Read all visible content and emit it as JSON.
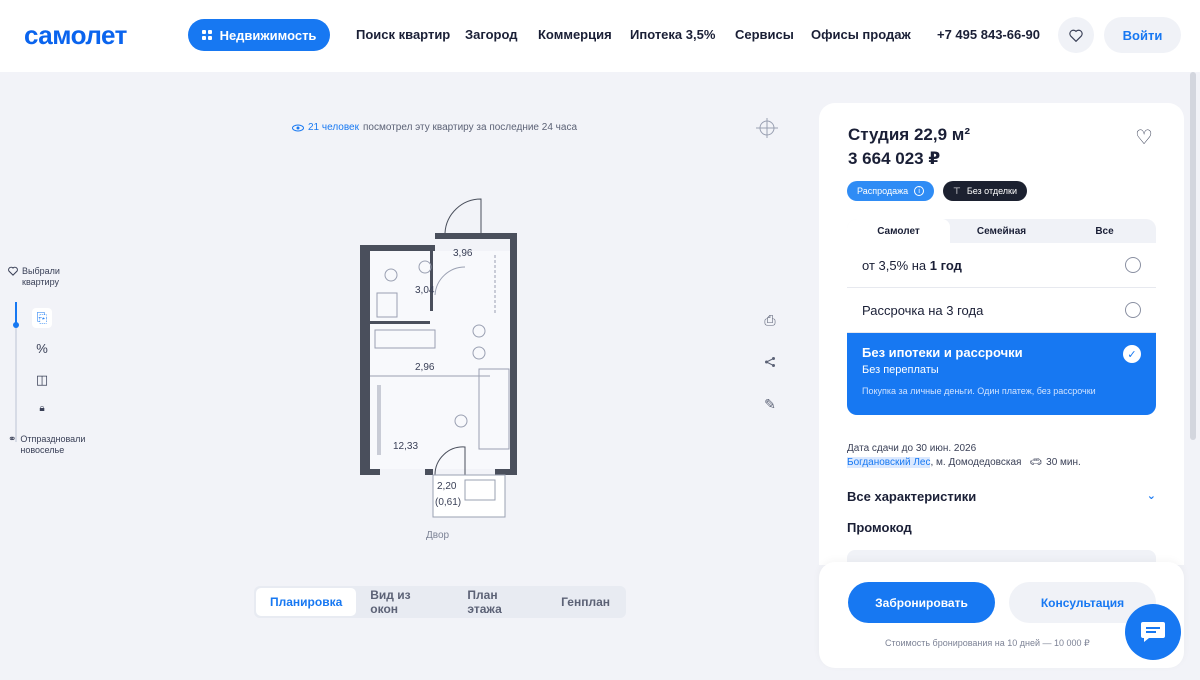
{
  "header": {
    "logo": "самолет",
    "nav_primary": "Недвижимость",
    "links": [
      "Поиск квартир",
      "Загород",
      "Коммерция",
      "Ипотека 3,5%",
      "Сервисы",
      "Офисы продаж"
    ],
    "phone": "+7 495 843-66-90",
    "login": "Войти"
  },
  "rail": {
    "top_label": "Выбрали квартиру",
    "bottom_label": "Отпраздновали новоселье"
  },
  "plan": {
    "views_count": "21 человек",
    "views_text": "посмотрел  эту квартиру за последние 24 часа",
    "rooms": [
      "3,96",
      "3,04",
      "2,96",
      "12,33",
      "2,20",
      "(0,61)"
    ],
    "yard": "Двор",
    "tabs": [
      "Планировка",
      "Вид из окон",
      "План этажа",
      "Генплан"
    ]
  },
  "card": {
    "title": "Студия 22,9 м²",
    "price": "3 664 023 ₽",
    "badge_sale": "Распродажа",
    "badge_finish": "Без отделки",
    "pay_tabs": [
      "Самолет",
      "Семейная",
      "Все"
    ],
    "option1_prefix": "от 3,5% на ",
    "option1_bold": "1 год",
    "option2": "Рассрочка на 3 года",
    "selected_title": "Без ипотеки и рассрочки",
    "selected_sub": "Без переплаты",
    "selected_desc": "Покупка за личные деньги. Один платеж, без рассрочки",
    "deadline": "Дата сдачи до 30 июн. 2026",
    "complex": "Богдановский Лес",
    "metro": ", м. Домодедовская",
    "drive": "30 мин.",
    "characteristics": "Все характеристики",
    "promo": "Промокод"
  },
  "booking": {
    "book": "Забронировать",
    "consult": "Консультация",
    "note": "Стоимость бронирования на 10 дней — 10 000 ₽"
  }
}
